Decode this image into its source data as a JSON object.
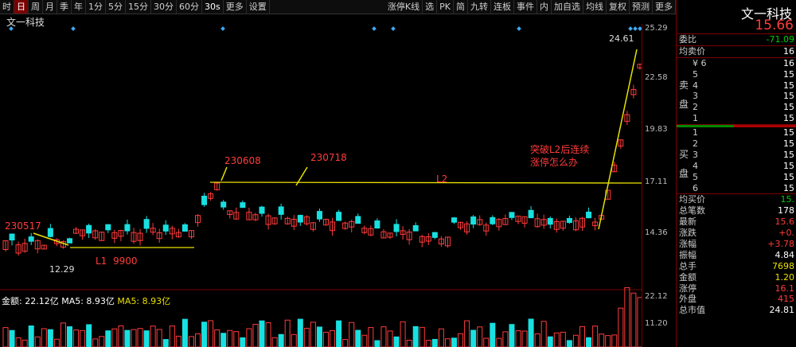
{
  "toolbar": {
    "items": [
      "时",
      "日",
      "周",
      "月",
      "季",
      "年",
      "1分",
      "5分",
      "15分",
      "30分",
      "60分",
      "30s",
      "更多",
      "设置"
    ],
    "items2": [
      "涨停K线",
      "选",
      "PK",
      "简",
      "九转",
      "连板",
      "事件",
      "内",
      "加自选",
      "均线",
      "复权",
      "预测",
      "更多"
    ]
  },
  "stock_name": "文一科技",
  "chart": {
    "axis_labels": [
      "25.29",
      "22.58",
      "19.83",
      "17.11",
      "14.36",
      "22.12",
      "11.20"
    ],
    "annotations": {
      "a1": "230517",
      "a2": "230608",
      "a3": "230718",
      "l1": "L1",
      "l1v": "9900",
      "l2": "L2",
      "note1": "突破L2后连续",
      "note2": "涨停怎么办",
      "high": "24.61",
      "low": "12.29"
    },
    "volume_label": "金额: 22.12亿",
    "ma5a": "MA5: 8.93亿",
    "ma5b": "MA5: 8.93亿"
  },
  "quote": {
    "name": "文一科技",
    "price": "15.66",
    "weibi_label": "委比",
    "weibi_value": "-71.09",
    "avg_sell_label": "均卖价",
    "avg_sell_value": "16",
    "sell_side": "卖 盘",
    "buy_side": "买 盘",
    "sell_levels": [
      {
        "n": "¥ 6",
        "p": "16"
      },
      {
        "n": "5",
        "p": "15"
      },
      {
        "n": "4",
        "p": "15"
      },
      {
        "n": "3",
        "p": "15"
      },
      {
        "n": "2",
        "p": "15"
      },
      {
        "n": "1",
        "p": "15"
      }
    ],
    "buy_levels": [
      {
        "n": "1",
        "p": "15"
      },
      {
        "n": "2",
        "p": "15"
      },
      {
        "n": "3",
        "p": "15"
      },
      {
        "n": "4",
        "p": "15"
      },
      {
        "n": "5",
        "p": "15"
      },
      {
        "n": "6",
        "p": "15"
      }
    ],
    "stats": [
      {
        "k": "均买价",
        "v": "15.",
        "c": "green"
      },
      {
        "k": "总笔数",
        "v": "178",
        "c": "white"
      },
      {
        "k": "最新",
        "v": "15.6",
        "c": "red"
      },
      {
        "k": "涨跌",
        "v": "+0.",
        "c": "red"
      },
      {
        "k": "涨幅",
        "v": "+3.78",
        "c": "red"
      },
      {
        "k": "振幅",
        "v": "4.84",
        "c": "white"
      },
      {
        "k": "总手",
        "v": "7698",
        "c": "yellow"
      },
      {
        "k": "金额",
        "v": "1.20",
        "c": "yellow"
      },
      {
        "k": "涨停",
        "v": "16.1",
        "c": "red"
      },
      {
        "k": "外盘",
        "v": "415",
        "c": "red"
      },
      {
        "k": "总市值",
        "v": "24.81",
        "c": "white"
      }
    ]
  },
  "colors": {
    "up": "#ff3b3b",
    "down": "#19e0e0",
    "annot": "#e8e000",
    "red_text": "#ff3b3b"
  }
}
